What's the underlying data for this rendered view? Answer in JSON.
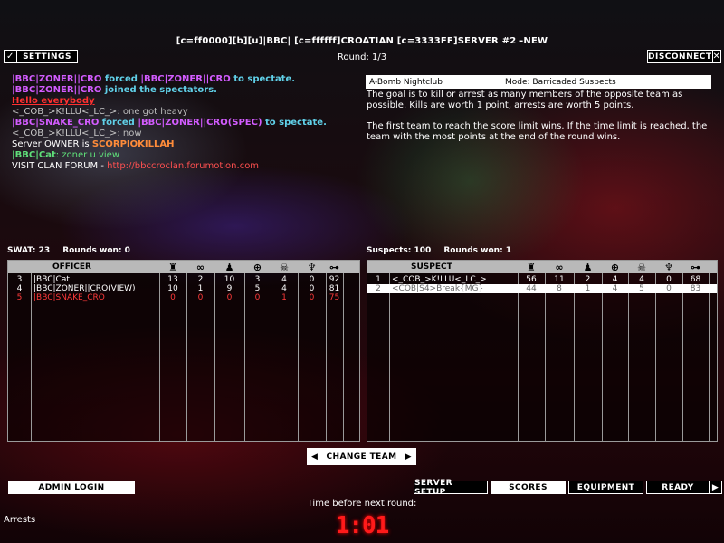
{
  "header": {
    "server_title": "[c=ff0000][b][u]|BBC| [c=ffffff]CROATIAN [c=3333FF]SERVER #2 -NEW",
    "round": "Round: 1/3",
    "settings_label": "SETTINGS",
    "disconnect_label": "DISCONNECT"
  },
  "chat": {
    "l1_a": "|BBC|ZONER||CRO",
    "l1_b": " forced ",
    "l1_c": "|BBC|ZONER||CRO",
    "l1_d": " to spectate.",
    "l2_a": "|BBC|ZONER||CRO",
    "l2_b": " joined the spectators.",
    "l3": "Hello everybody",
    "l4_a": "<_COB_>K!LLU<_LC_>",
    "l4_b": ": one got heavy",
    "l5_a": "|BBC|SNAKE_CRO",
    "l5_b": " forced ",
    "l5_c": "|BBC|ZONER||CRO(SPEC)",
    "l5_d": " to spectate.",
    "l6_a": "<_COB_>K!LLU<_LC_>",
    "l6_b": ": now",
    "l7_a": "Server OWNER is ",
    "l7_b": "SCORPIOKILLAH",
    "l8_a": "|BBC|Cat",
    "l8_b": ": zoner u view",
    "l9_a": "VISIT CLAN FORUM - ",
    "l9_b": "http://bbccroclan.forumotion.com"
  },
  "map_info": {
    "name": "A-Bomb Nightclub",
    "mode": "Mode: Barricaded Suspects",
    "desc1": "The goal is to kill or arrest as many members of the opposite team as possible.  Kills are worth 1 point, arrests are worth 5 points.",
    "desc2": "The first team to reach the score limit wins.  If the time limit is reached, the team with the most points at the end of the round wins."
  },
  "swat": {
    "header_score": "SWAT: 23",
    "header_rounds": "Rounds won: 0",
    "column_title": "OFFICER",
    "rows": [
      {
        "id": "3",
        "name": "|BBC|Cat",
        "c1": "13",
        "c2": "2",
        "c3": "10",
        "c4": "3",
        "c5": "4",
        "c6": "0",
        "c7": "92"
      },
      {
        "id": "4",
        "name": "|BBC|ZONER||CRO(VIEW)",
        "c1": "10",
        "c2": "1",
        "c3": "9",
        "c4": "5",
        "c5": "4",
        "c6": "0",
        "c7": "81"
      },
      {
        "id": "5",
        "name": "|BBC|SNAKE_CRO",
        "c1": "0",
        "c2": "0",
        "c3": "0",
        "c4": "0",
        "c5": "1",
        "c6": "0",
        "c7": "75"
      }
    ]
  },
  "suspects": {
    "header_score": "Suspects: 100",
    "header_rounds": "Rounds won: 1",
    "column_title": "SUSPECT",
    "rows": [
      {
        "id": "1",
        "name": "<_COB_>K!LLU<_LC_>",
        "c1": "56",
        "c2": "11",
        "c3": "2",
        "c4": "4",
        "c5": "4",
        "c6": "0",
        "c7": "68"
      },
      {
        "id": "2",
        "name": "<COB|S4>Break{MG}",
        "c1": "44",
        "c2": "8",
        "c3": "1",
        "c4": "4",
        "c5": "5",
        "c6": "0",
        "c7": "83"
      }
    ]
  },
  "column_icons": [
    "trophy-icon",
    "handcuffs-icon",
    "kneeling-icon",
    "crosshair-icon",
    "skull-icon",
    "medal-icon",
    "network-icon"
  ],
  "footer": {
    "change_team": "CHANGE TEAM",
    "admin_login": "ADMIN LOGIN",
    "server_setup": "SERVER SETUP",
    "scores": "SCORES",
    "equipment": "EQUIPMENT",
    "ready": "READY",
    "time_label": "Time before next round:",
    "timer": "1:01",
    "objective": "Arrests"
  },
  "colors": {
    "accent_red": "#ff1a1a",
    "chat_magenta": "#d35cff",
    "chat_cyan": "#60d0e8",
    "chat_green": "#5fe07a",
    "chat_orange": "#ff8c3a"
  }
}
